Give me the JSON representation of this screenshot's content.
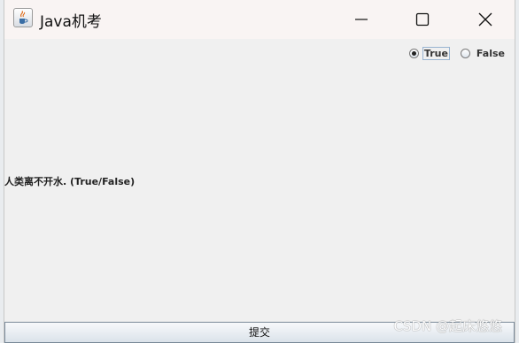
{
  "window": {
    "title": "Java机考",
    "app_icon": "java-cup-icon",
    "controls": {
      "minimize": "minimize-icon",
      "maximize": "maximize-icon",
      "close": "close-icon"
    }
  },
  "answer_options": [
    {
      "label": "True",
      "selected": true
    },
    {
      "label": "False",
      "selected": false
    }
  ],
  "question": "人类离不开水. (True/False)",
  "submit_label": "提交",
  "watermark": "CSDN @起床悠悠",
  "colors": {
    "window_bg": "#f0f0f0",
    "titlebar_bg": "#f9f4f3",
    "button_border": "#7a8a99",
    "focus_border": "#99b4d1"
  }
}
